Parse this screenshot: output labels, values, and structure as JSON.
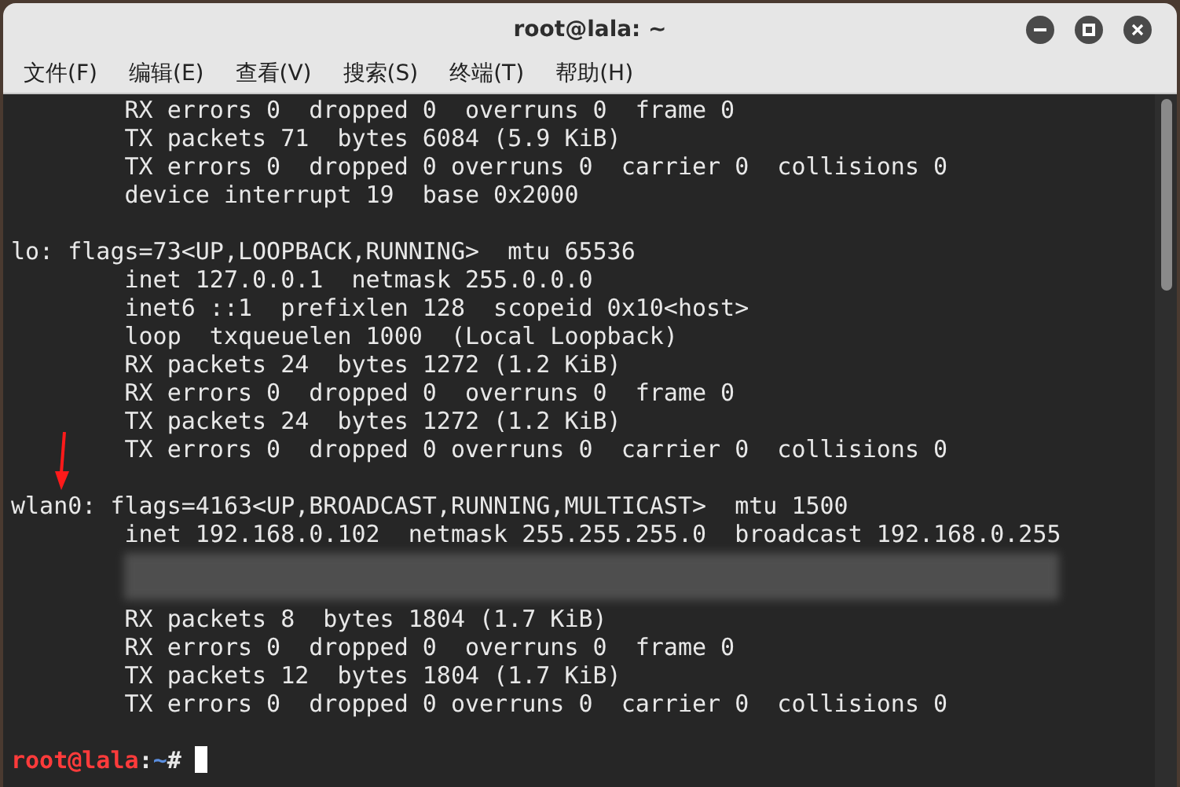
{
  "window": {
    "title": "root@lala: ~"
  },
  "menu": [
    "文件(F)",
    "编辑(E)",
    "查看(V)",
    "搜索(S)",
    "终端(T)",
    "帮助(H)"
  ],
  "terminal": {
    "lines": [
      {
        "kind": "text",
        "text": "        RX errors 0  dropped 0  overruns 0  frame 0"
      },
      {
        "kind": "text",
        "text": "        TX packets 71  bytes 6084 (5.9 KiB)"
      },
      {
        "kind": "text",
        "text": "        TX errors 0  dropped 0 overruns 0  carrier 0  collisions 0"
      },
      {
        "kind": "text",
        "text": "        device interrupt 19  base 0x2000"
      },
      {
        "kind": "blank"
      },
      {
        "kind": "text",
        "text": "lo: flags=73<UP,LOOPBACK,RUNNING>  mtu 65536"
      },
      {
        "kind": "text",
        "text": "        inet 127.0.0.1  netmask 255.0.0.0"
      },
      {
        "kind": "text",
        "text": "        inet6 ::1  prefixlen 128  scopeid 0x10<host>"
      },
      {
        "kind": "text",
        "text": "        loop  txqueuelen 1000  (Local Loopback)"
      },
      {
        "kind": "text",
        "text": "        RX packets 24  bytes 1272 (1.2 KiB)"
      },
      {
        "kind": "text",
        "text": "        RX errors 0  dropped 0  overruns 0  frame 0"
      },
      {
        "kind": "text",
        "text": "        TX packets 24  bytes 1272 (1.2 KiB)"
      },
      {
        "kind": "text",
        "text": "        TX errors 0  dropped 0 overruns 0  carrier 0  collisions 0"
      },
      {
        "kind": "blank"
      },
      {
        "kind": "text",
        "text": "wlan0: flags=4163<UP,BROADCAST,RUNNING,MULTICAST>  mtu 1500"
      },
      {
        "kind": "text",
        "text": "        inet 192.168.0.102  netmask 255.255.255.0  broadcast 192.168.0.255"
      },
      {
        "kind": "redacted"
      },
      {
        "kind": "text",
        "text": "        RX packets 8  bytes 1804 (1.7 KiB)"
      },
      {
        "kind": "text",
        "text": "        RX errors 0  dropped 0  overruns 0  frame 0"
      },
      {
        "kind": "text",
        "text": "        TX packets 12  bytes 1804 (1.7 KiB)"
      },
      {
        "kind": "text",
        "text": "        TX errors 0  dropped 0 overruns 0  carrier 0  collisions 0"
      },
      {
        "kind": "blank"
      },
      {
        "kind": "prompt",
        "user": "root@lala",
        "separator": ":",
        "path": "~",
        "symbol": "#"
      }
    ]
  }
}
